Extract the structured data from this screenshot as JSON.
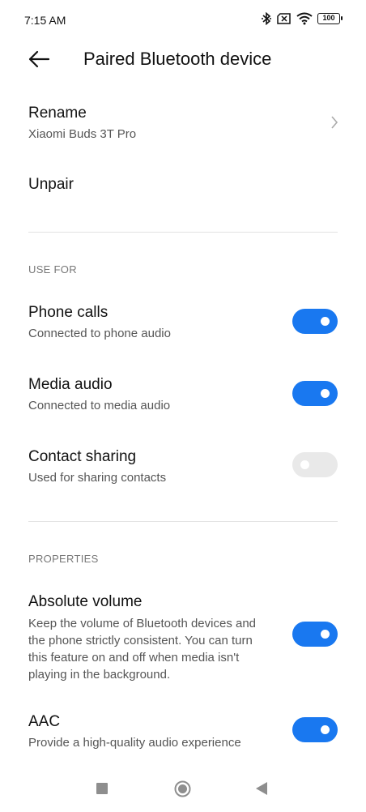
{
  "status": {
    "time": "7:15 AM",
    "battery": "100"
  },
  "header": {
    "title": "Paired Bluetooth device"
  },
  "rename": {
    "title": "Rename",
    "value": "Xiaomi Buds 3T Pro"
  },
  "unpair": {
    "title": "Unpair"
  },
  "use_for": {
    "section_label": "USE FOR",
    "items": [
      {
        "title": "Phone calls",
        "subtitle": "Connected to phone audio",
        "enabled": true
      },
      {
        "title": "Media audio",
        "subtitle": "Connected to media audio",
        "enabled": true
      },
      {
        "title": "Contact sharing",
        "subtitle": "Used for sharing contacts",
        "enabled": false
      }
    ]
  },
  "properties": {
    "section_label": "PROPERTIES",
    "items": [
      {
        "title": "Absolute volume",
        "subtitle_lines": [
          "Keep the volume of Bluetooth devices and",
          "the phone strictly consistent. You can turn",
          "this feature on and off when media isn't",
          "playing in the background."
        ],
        "enabled": true
      },
      {
        "title": "AAC",
        "subtitle": "Provide a high-quality audio experience",
        "enabled": true
      }
    ]
  },
  "colors": {
    "toggle_on": "#1978f0",
    "toggle_off": "#e9e9e9"
  },
  "nav": {
    "icons": [
      "recent-apps-icon",
      "home-icon",
      "back-icon"
    ]
  }
}
